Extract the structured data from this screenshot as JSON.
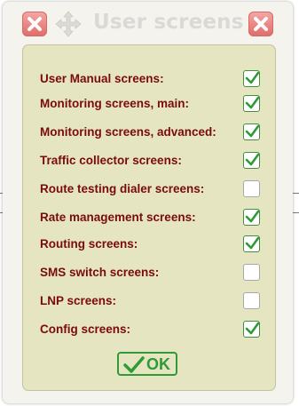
{
  "window": {
    "title": "User screens",
    "left_icon": "close-icon",
    "move_icon": "move-icon",
    "right_icon": "close-icon"
  },
  "options": [
    {
      "label": "User Manual screens:",
      "checked": true
    },
    {
      "label": "Monitoring screens, main:",
      "checked": true
    },
    {
      "label": "Monitoring screens, advanced:",
      "checked": true
    },
    {
      "label": "Traffic collector screens:",
      "checked": true
    },
    {
      "label": "Route testing dialer screens:",
      "checked": false
    },
    {
      "label": "Rate management screens:",
      "checked": true
    },
    {
      "label": "Routing screens:",
      "checked": true
    },
    {
      "label": "SMS switch screens:",
      "checked": false
    },
    {
      "label": "LNP screens:",
      "checked": false
    },
    {
      "label": "Config screens:",
      "checked": true
    }
  ],
  "ok_button": {
    "label": "OK",
    "icon": "checkmark-icon"
  },
  "colors": {
    "label_text": "#7a0b0b",
    "panel_bg": "#e6e5c1",
    "check_green": "#2f9a36",
    "close_red": "#e06c69",
    "title_text": "#d9d9d5"
  }
}
